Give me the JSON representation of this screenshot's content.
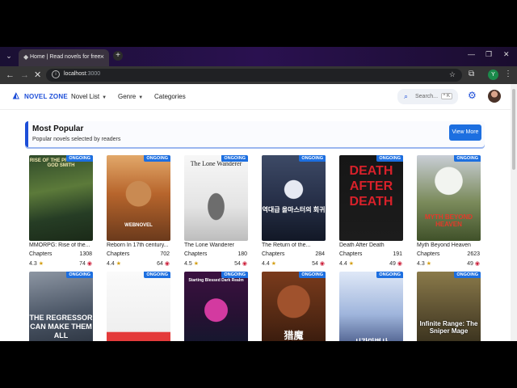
{
  "browser": {
    "tab_title": "Home | Read novels for free",
    "url_host": "localhost",
    "url_port": ":3000",
    "profile_initial": "Y"
  },
  "nav": {
    "logo": "NOVEL ZONE",
    "links": [
      "Novel List",
      "Genre",
      "Categories"
    ],
    "search_placeholder": "Search...",
    "search_shortcut": "^ K"
  },
  "section": {
    "title": "Most Popular",
    "subtitle": "Popular novels selected by readers",
    "view_more": "View More"
  },
  "status_badge": "ONGOING",
  "chapters_label": "Chapters",
  "novels": [
    {
      "title": "MMORPG: Rise of the...",
      "chapters": "1308",
      "rating": "4.3",
      "views": "74",
      "cover_text": "RISE OF THE PRIMORDIAL GOD SMITH"
    },
    {
      "title": "Reborn In 17th century...",
      "chapters": "702",
      "rating": "4.4",
      "views": "64",
      "cover_text": "WEBNOVEL"
    },
    {
      "title": "The Lone Wanderer",
      "chapters": "180",
      "rating": "4.5",
      "views": "54",
      "cover_text": "The Lone Wanderer"
    },
    {
      "title": "The Return of the...",
      "chapters": "284",
      "rating": "4.4",
      "views": "54",
      "cover_text": "역대급 올마스터의 회귀"
    },
    {
      "title": "Death After Death",
      "chapters": "191",
      "rating": "4.4",
      "views": "49",
      "cover_text": "DEATH AFTER DEATH"
    },
    {
      "title": "Myth Beyond Heaven",
      "chapters": "2623",
      "rating": "4.3",
      "views": "49",
      "cover_text": "MYTH BEYOND HEAVEN"
    },
    {
      "title": "",
      "chapters": "",
      "rating": "",
      "views": "",
      "cover_text": "THE REGRESSOR CAN MAKE THEM ALL"
    },
    {
      "title": "",
      "chapters": "",
      "rating": "",
      "views": "",
      "cover_text": ""
    },
    {
      "title": "",
      "chapters": "",
      "rating": "",
      "views": "",
      "cover_text": "Starting Blessed Dark Realm"
    },
    {
      "title": "",
      "chapters": "",
      "rating": "",
      "views": "",
      "cover_text": "猎魔"
    },
    {
      "title": "",
      "chapters": "",
      "rating": "",
      "views": "",
      "cover_text": "시간마법사"
    },
    {
      "title": "",
      "chapters": "",
      "rating": "",
      "views": "",
      "cover_text": "Infinite Range: The Sniper Mage"
    }
  ],
  "colors": {
    "accent": "#1d4ed8",
    "badge": "#1d6fe0",
    "star": "#d4a017",
    "eye": "#cc1f3a"
  }
}
